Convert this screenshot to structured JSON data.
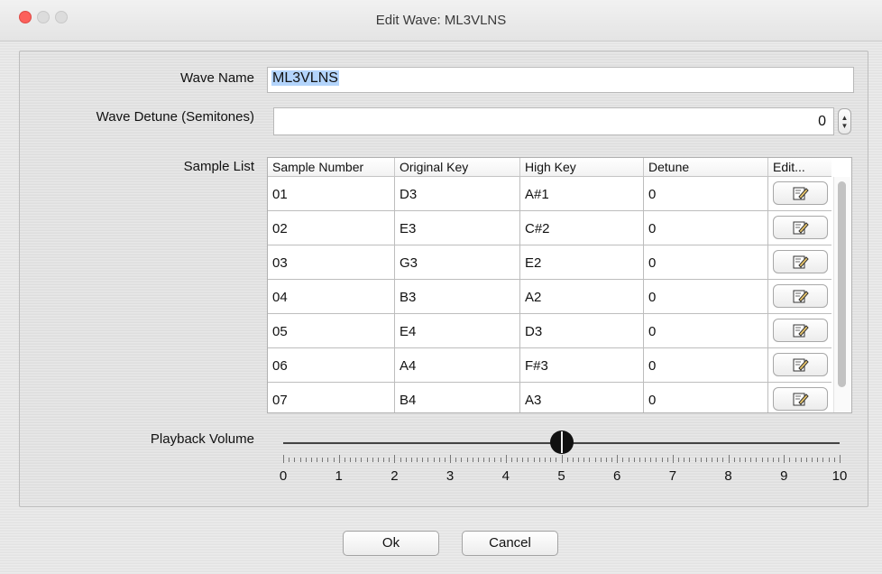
{
  "window": {
    "title": "Edit Wave: ML3VLNS"
  },
  "form": {
    "wave_name_label": "Wave Name",
    "wave_name_value": "ML3VLNS",
    "detune_label": "Wave Detune (Semitones)",
    "detune_value": "0",
    "sample_list_label": "Sample List",
    "playback_label": "Playback Volume"
  },
  "table": {
    "headers": [
      "Sample Number",
      "Original Key",
      "High Key",
      "Detune",
      "Edit..."
    ],
    "rows": [
      [
        "01",
        "D3",
        "A#1",
        "0"
      ],
      [
        "02",
        "E3",
        "C#2",
        "0"
      ],
      [
        "03",
        "G3",
        "E2",
        "0"
      ],
      [
        "04",
        "B3",
        "A2",
        "0"
      ],
      [
        "05",
        "E4",
        "D3",
        "0"
      ],
      [
        "06",
        "A4",
        "F#3",
        "0"
      ],
      [
        "07",
        "B4",
        "A3",
        "0"
      ]
    ]
  },
  "slider": {
    "min": 0,
    "max": 10,
    "value": 5,
    "labels": [
      "0",
      "1",
      "2",
      "3",
      "4",
      "5",
      "6",
      "7",
      "8",
      "9",
      "10"
    ]
  },
  "buttons": {
    "ok": "Ok",
    "cancel": "Cancel"
  },
  "icons": {
    "edit": "edit-pencil-icon",
    "stepper": "stepper-arrows-icon"
  },
  "colors": {
    "close": "#fc605b",
    "selection": "#b3d4fb"
  }
}
